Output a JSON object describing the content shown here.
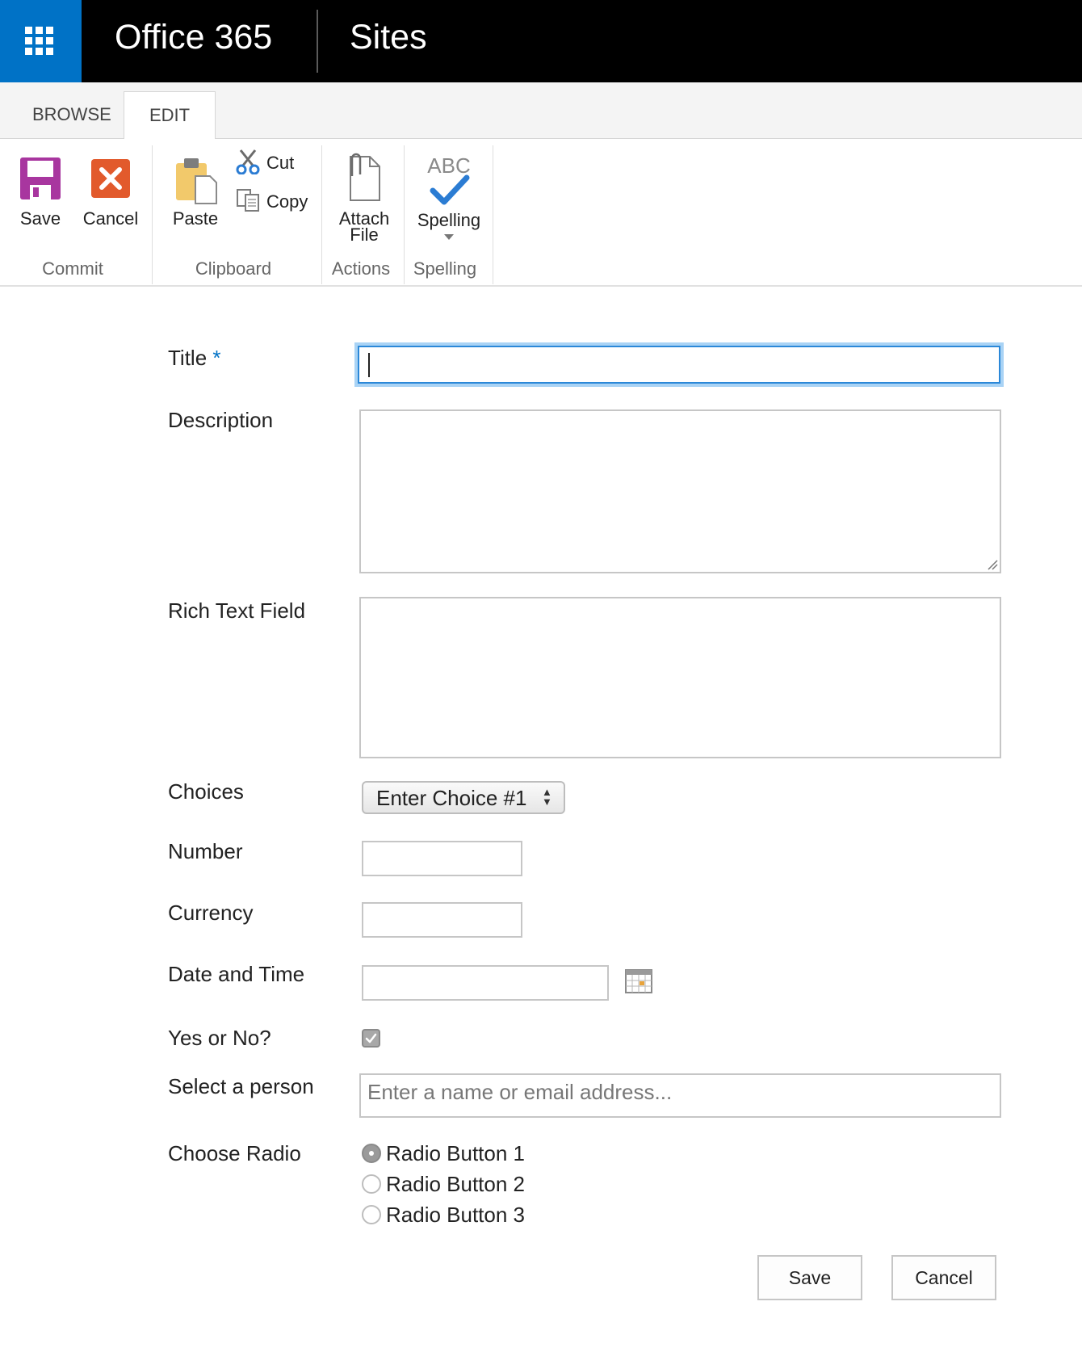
{
  "suite_bar": {
    "brand": "Office 365",
    "site": "Sites",
    "accent_color": "#0072c6"
  },
  "ribbon": {
    "tabs": [
      "BROWSE",
      "EDIT"
    ],
    "active_tab": "EDIT",
    "groups": {
      "commit": {
        "label": "Commit",
        "save": "Save",
        "cancel": "Cancel"
      },
      "clipboard": {
        "label": "Clipboard",
        "paste": "Paste",
        "cut": "Cut",
        "copy": "Copy"
      },
      "actions": {
        "label": "Actions",
        "attach_line1": "Attach",
        "attach_line2": "File"
      },
      "spelling": {
        "label": "Spelling",
        "button": "Spelling",
        "icon_text": "ABC"
      }
    }
  },
  "form": {
    "title": {
      "label": "Title",
      "required_marker": "*",
      "value": ""
    },
    "description": {
      "label": "Description",
      "value": ""
    },
    "rich_text": {
      "label": "Rich Text Field",
      "value": ""
    },
    "choices": {
      "label": "Choices",
      "selected": "Enter Choice #1"
    },
    "number": {
      "label": "Number",
      "value": ""
    },
    "currency": {
      "label": "Currency",
      "value": ""
    },
    "date_time": {
      "label": "Date and Time",
      "value": ""
    },
    "yes_no": {
      "label": "Yes or No?",
      "checked": true
    },
    "person": {
      "label": "Select a person",
      "placeholder": "Enter a name or email address..."
    },
    "radio": {
      "label": "Choose Radio",
      "options": [
        "Radio Button 1",
        "Radio Button 2",
        "Radio Button 3"
      ],
      "selected_index": 0
    },
    "buttons": {
      "save": "Save",
      "cancel": "Cancel"
    }
  }
}
